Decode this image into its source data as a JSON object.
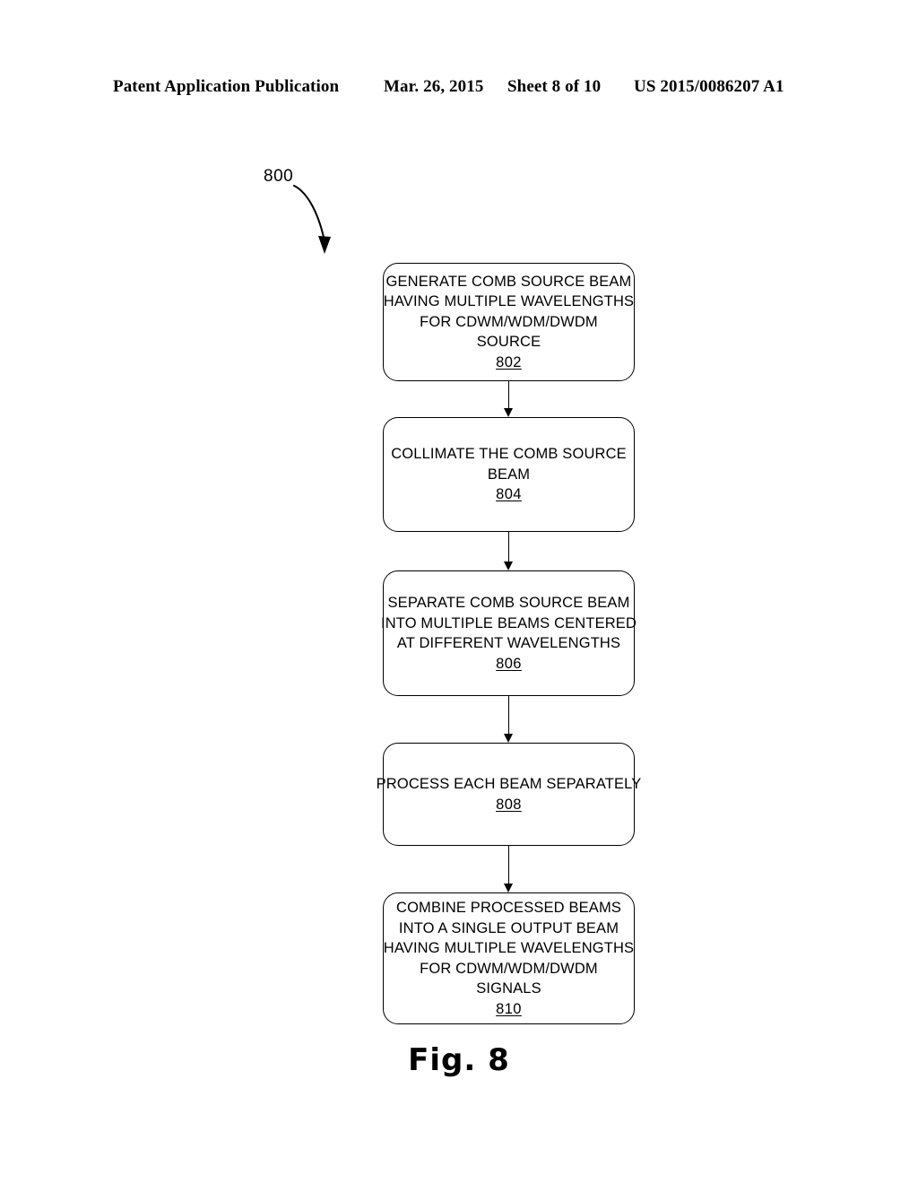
{
  "header": {
    "publication": "Patent Application Publication",
    "date": "Mar. 26, 2015",
    "sheet": "Sheet 8 of 10",
    "doc_number": "US 2015/0086207 A1"
  },
  "figure": {
    "reference_numeral": "800",
    "caption": "Fig. 8",
    "lead_line_icon": "curved-arrow-icon",
    "steps": [
      {
        "id": "802",
        "lines": [
          "GENERATE COMB SOURCE BEAM",
          "HAVING MULTIPLE WAVELENGTHS",
          "FOR CDWM/WDM/DWDM",
          "SOURCE"
        ],
        "number": "802"
      },
      {
        "id": "804",
        "lines": [
          "COLLIMATE THE COMB SOURCE",
          "BEAM"
        ],
        "number": "804"
      },
      {
        "id": "806",
        "lines": [
          "SEPARATE COMB SOURCE BEAM",
          "INTO MULTIPLE BEAMS CENTERED",
          "AT DIFFERENT WAVELENGTHS"
        ],
        "number": "806"
      },
      {
        "id": "808",
        "lines": [
          "PROCESS EACH BEAM SEPARATELY"
        ],
        "number": "808"
      },
      {
        "id": "810",
        "lines": [
          "COMBINE PROCESSED BEAMS",
          "INTO A SINGLE OUTPUT BEAM",
          "HAVING MULTIPLE WAVELENGTHS",
          "FOR CDWM/WDM/DWDM",
          "SIGNALS"
        ],
        "number": "810"
      }
    ],
    "connectors": [
      {
        "from": "802",
        "to": "804",
        "icon": "down-arrow-icon"
      },
      {
        "from": "804",
        "to": "806",
        "icon": "down-arrow-icon"
      },
      {
        "from": "806",
        "to": "808",
        "icon": "down-arrow-icon"
      },
      {
        "from": "808",
        "to": "810",
        "icon": "down-arrow-icon"
      }
    ]
  },
  "colors": {
    "ink": "#000000",
    "page": "#ffffff"
  }
}
